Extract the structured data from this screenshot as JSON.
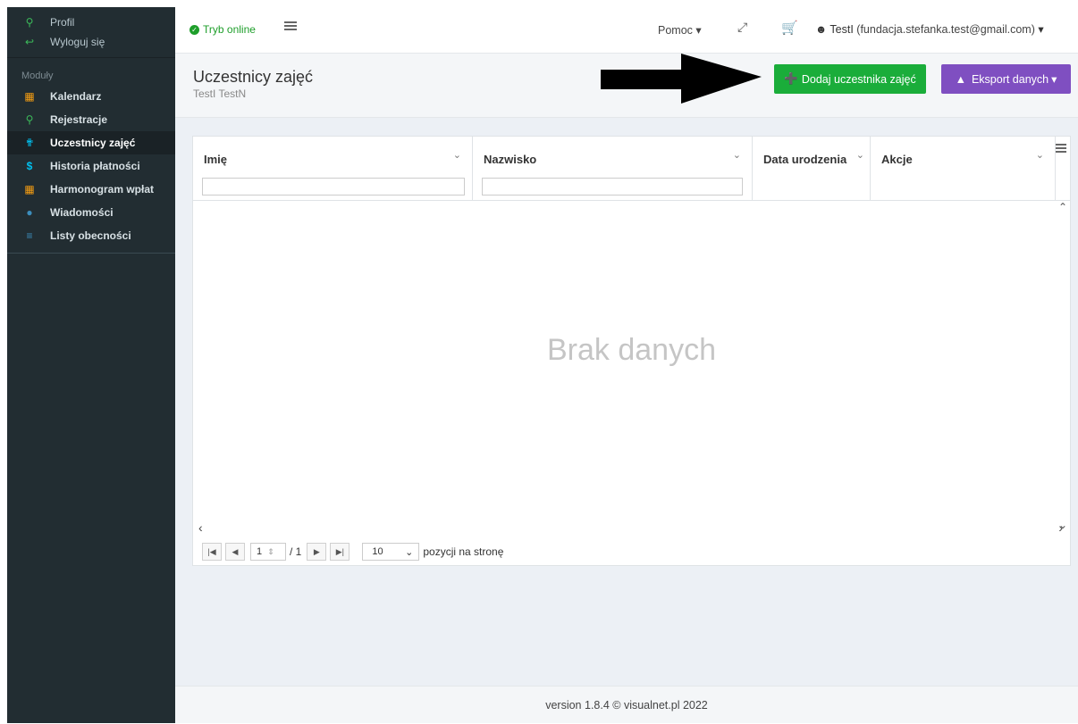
{
  "sidebar": {
    "top": [
      {
        "label": "Profil",
        "icon": "user-icon"
      },
      {
        "label": "Wyloguj się",
        "icon": "logout-icon"
      }
    ],
    "section_label": "Moduły",
    "items": [
      {
        "label": "Kalendarz",
        "icon": "calendar-icon"
      },
      {
        "label": "Rejestracje",
        "icon": "user-icon"
      },
      {
        "label": "Uczestnicy zajęć",
        "icon": "person-icon"
      },
      {
        "label": "Historia płatności",
        "icon": "dollar-icon"
      },
      {
        "label": "Harmonogram wpłat",
        "icon": "calendar-icon"
      },
      {
        "label": "Wiadomości",
        "icon": "chat-icon"
      },
      {
        "label": "Listy obecności",
        "icon": "list-icon"
      }
    ]
  },
  "topbar": {
    "status": "Tryb online",
    "help": "Pomoc",
    "user_name": "TestI",
    "user_email": "(fundacja.stefanka.test@gmail.com)"
  },
  "header": {
    "title": "Uczestnicy zajęć",
    "subtitle": "TestI TestN",
    "add_button": "Dodaj uczestnika zajęć",
    "export_button": "Eksport danych"
  },
  "grid": {
    "columns": [
      "Imię",
      "Nazwisko",
      "Data urodzenia",
      "Akcje"
    ],
    "empty_text": "Brak danych",
    "page_value": "1",
    "page_total": "/ 1",
    "page_size": "10",
    "page_size_label": "pozycji na stronę"
  },
  "footer": {
    "text": "version 1.8.4 © visualnet.pl 2022"
  },
  "colors": {
    "sidebar_bg": "#222d32",
    "add_button": "#1aad3a",
    "export_button": "#7f4fc1",
    "online": "#1e9e2a"
  }
}
